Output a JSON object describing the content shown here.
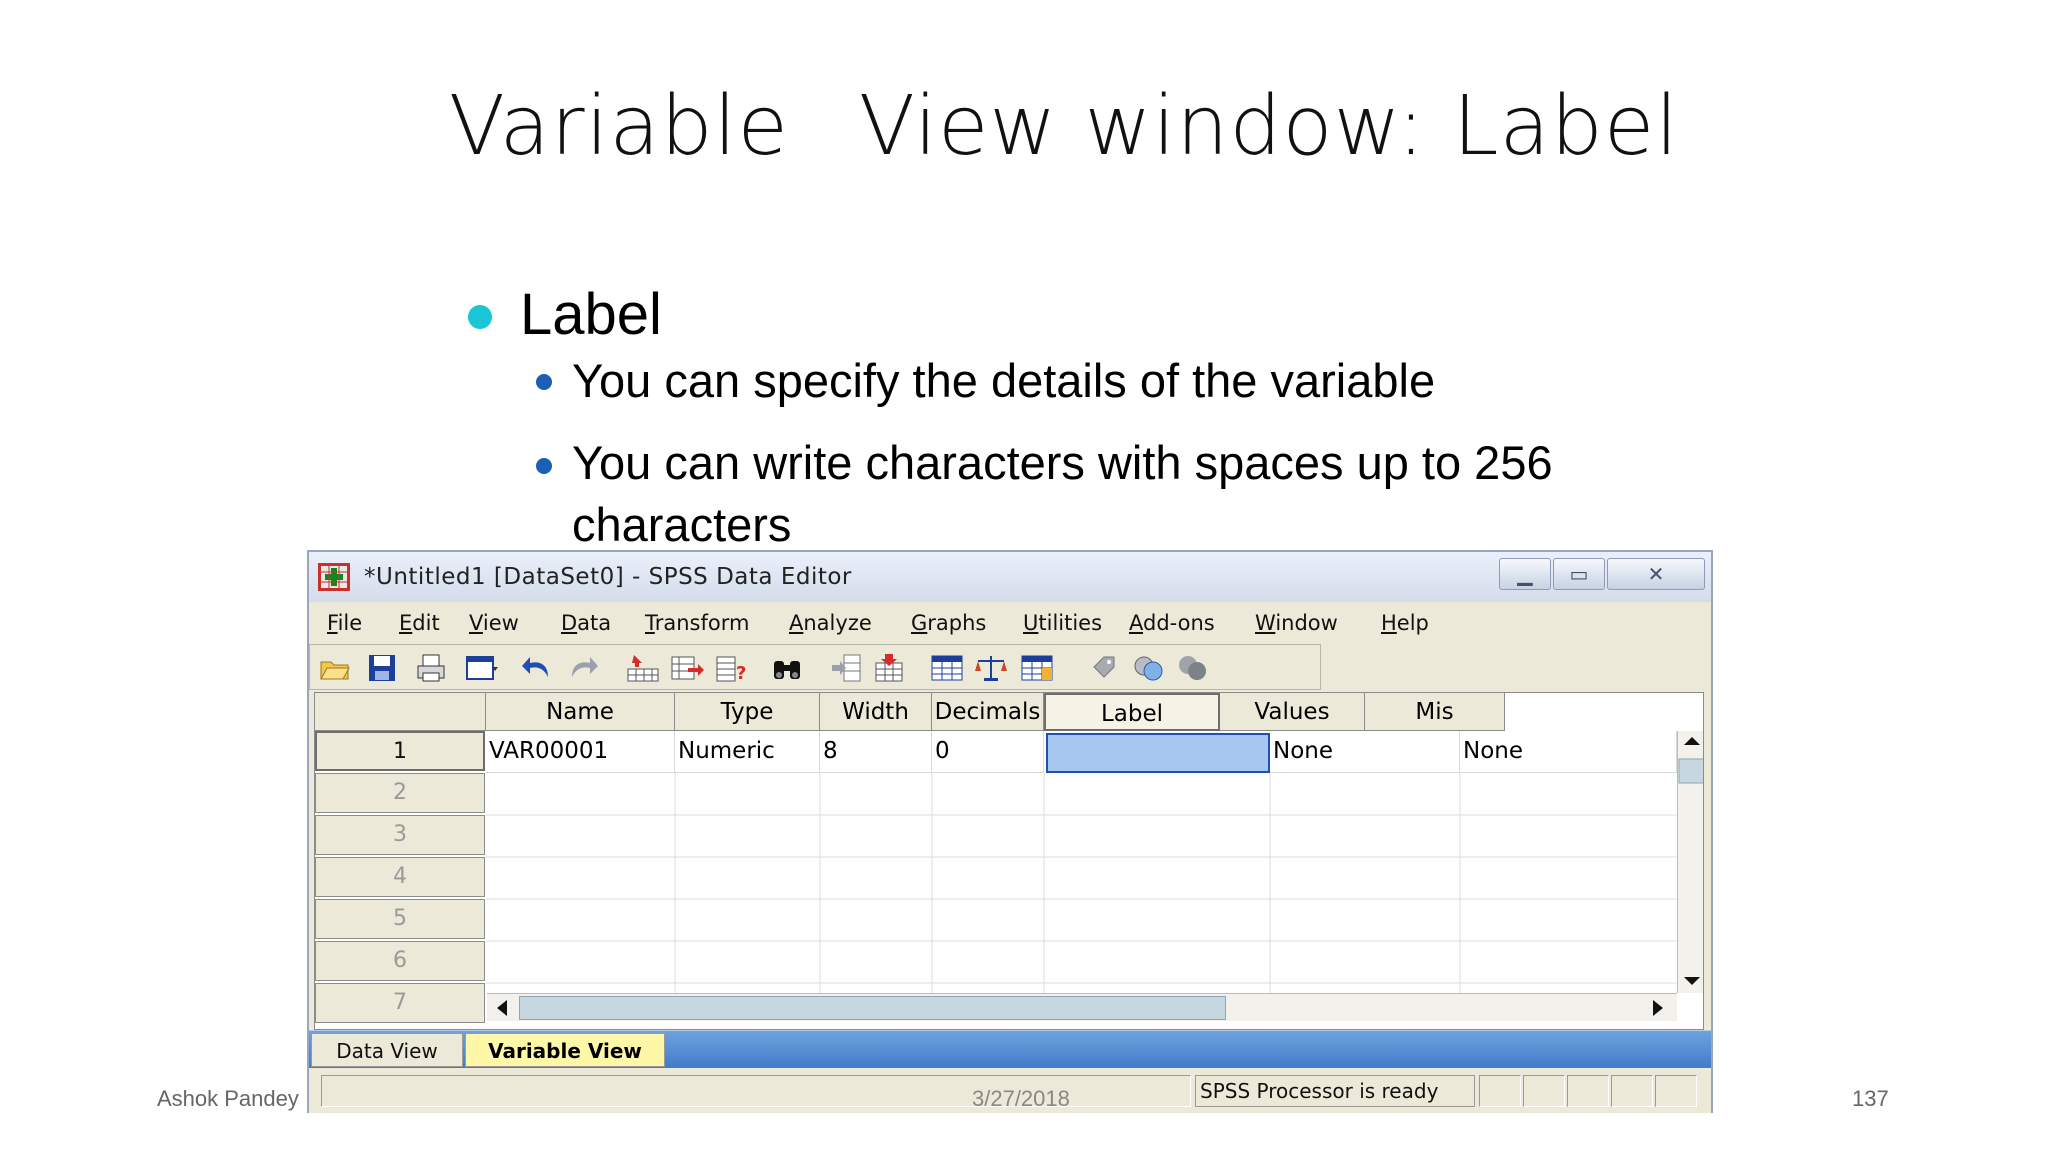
{
  "slide": {
    "title_part1": "Variable",
    "title_part2": "View window: Label",
    "bullet_main": "Label",
    "bullet_sub1": "You can specify the details of the variable",
    "bullet_sub2": "You can write characters with spaces up to 256 characters"
  },
  "window": {
    "title": "*Untitled1 [DataSet0] - SPSS Data Editor",
    "minimize_symbol": "▁",
    "maximize_symbol": "▭",
    "close_symbol": "✕"
  },
  "menu": [
    "File",
    "Edit",
    "View",
    "Data",
    "Transform",
    "Analyze",
    "Graphs",
    "Utilities",
    "Add-ons",
    "Window",
    "Help"
  ],
  "toolbar_icons": [
    "open-folder-icon",
    "save-icon",
    "print-icon",
    "dialog-recall-icon",
    "undo-icon",
    "redo-icon",
    "goto-case-icon",
    "goto-variable-icon",
    "variables-icon",
    "find-icon",
    "insert-cases-icon",
    "insert-variable-icon",
    "split-file-icon",
    "weight-cases-icon",
    "select-cases-icon",
    "value-labels-icon",
    "use-sets-icon",
    "show-all-variables-icon"
  ],
  "grid": {
    "columns": [
      "Name",
      "Type",
      "Width",
      "Decimals",
      "Label",
      "Values",
      "Mis"
    ],
    "row_numbers": [
      "1",
      "2",
      "3",
      "4",
      "5",
      "6",
      "7"
    ],
    "row1": [
      "VAR00001",
      "Numeric",
      "8",
      "0",
      "",
      "None",
      "None"
    ],
    "selected_column": "Label"
  },
  "tabs": {
    "data_view": "Data View",
    "variable_view": "Variable View"
  },
  "status": {
    "processor": "SPSS  Processor is ready"
  },
  "footer": {
    "author": "Ashok Pandey",
    "date": "3/27/2018",
    "page": "137"
  },
  "colors": {
    "accent_bullet": "#19c6d6",
    "sub_bullet": "#1b5fb6",
    "selected_cell": "#a6c7ef",
    "active_tab": "#fff7a8"
  }
}
